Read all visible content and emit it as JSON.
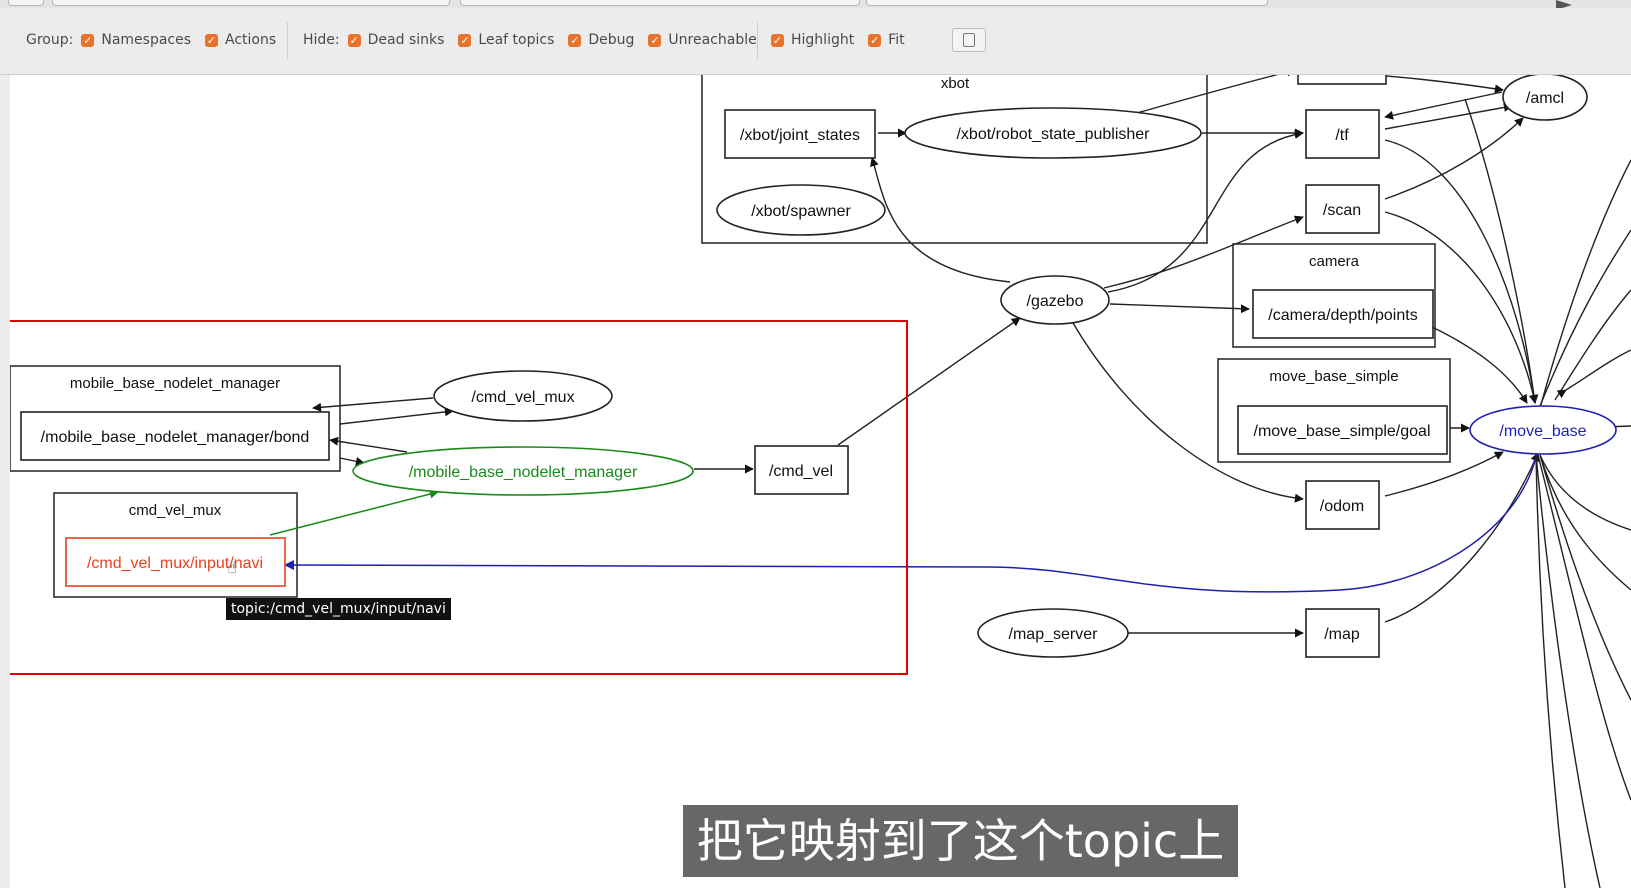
{
  "toolbar": {
    "group_label": "Group:",
    "group_options": [
      {
        "label": "Namespaces",
        "checked": true
      },
      {
        "label": "Actions",
        "checked": true
      }
    ],
    "hide_label": "Hide:",
    "hide_options": [
      {
        "label": "Dead sinks",
        "checked": true
      },
      {
        "label": "Leaf topics",
        "checked": true
      },
      {
        "label": "Debug",
        "checked": true
      },
      {
        "label": "Unreachable",
        "checked": true
      }
    ],
    "view_options": [
      {
        "label": "Highlight",
        "checked": true
      },
      {
        "label": "Fit",
        "checked": true
      }
    ],
    "fit_button_icon": "fit-window-icon",
    "checkbox_color": "#e8732c"
  },
  "graph": {
    "clusters": {
      "xbot": "xbot",
      "camera": "camera",
      "move_base_simple": "move_base_simple",
      "mobile_base_nodelet_manager": "mobile_base_nodelet_manager",
      "cmd_vel_mux": "cmd_vel_mux"
    },
    "nodes": {
      "joint_states": "/xbot/joint_states",
      "robot_state_publisher": "/xbot/robot_state_publisher",
      "spawner": "/xbot/spawner",
      "tf": "/tf",
      "amcl": "/amcl",
      "scan": "/scan",
      "gazebo": "/gazebo",
      "camera_points": "/camera/depth/points",
      "goal": "/move_base_simple/goal",
      "move_base": "/move_base",
      "odom": "/odom",
      "map_server": "/map_server",
      "map": "/map",
      "bond": "/mobile_base_nodelet_manager/bond",
      "cmd_vel_mux": "/cmd_vel_mux",
      "mobile_base_nodelet_manager": "/mobile_base_nodelet_manager",
      "cmd_vel": "/cmd_vel",
      "input_navi": "/cmd_vel_mux/input/navi"
    },
    "colors": {
      "selected_topic": "#e8421e",
      "highlight_node": "#1a8a1a",
      "highlight_subscriber": "#1f1fb0",
      "annotation_box": "#e00000"
    }
  },
  "tooltip": "topic:/cmd_vel_mux/input/navi",
  "cursor_icon": "hand-pointer-icon",
  "subtitle": "把它映射到了这个topic上"
}
